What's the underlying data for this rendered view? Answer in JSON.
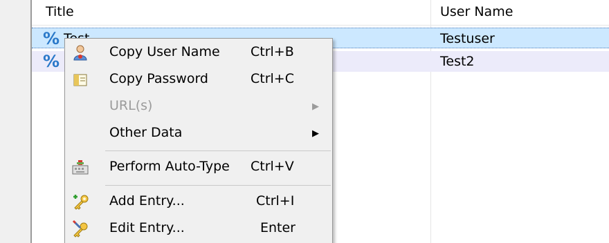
{
  "list": {
    "columns": {
      "title": "Title",
      "user_name": "User Name"
    },
    "rows": [
      {
        "title": "Test",
        "user_name": "Testuser",
        "icon": "percent-key-icon"
      },
      {
        "title": "",
        "user_name": "Test2",
        "icon": "percent-key-icon"
      }
    ]
  },
  "context_menu": {
    "items": [
      {
        "label": "Copy User Name",
        "shortcut": "Ctrl+B",
        "icon": "user-icon",
        "enabled": true
      },
      {
        "label": "Copy Password",
        "shortcut": "Ctrl+C",
        "icon": "key-icon",
        "enabled": true
      },
      {
        "label": "URL(s)",
        "shortcut": "",
        "icon": "",
        "enabled": false,
        "submenu": true
      },
      {
        "label": "Other Data",
        "shortcut": "",
        "icon": "",
        "enabled": true,
        "submenu": true
      },
      {
        "label": "Perform Auto-Type",
        "shortcut": "Ctrl+V",
        "icon": "keyboard-icon",
        "enabled": true
      },
      {
        "label": "Add Entry...",
        "shortcut": "Ctrl+I",
        "icon": "add-key-icon",
        "enabled": true
      },
      {
        "label": "Edit Entry...",
        "shortcut": "Enter",
        "icon": "edit-key-icon",
        "enabled": true
      }
    ]
  },
  "colors": {
    "selection": "#cce8ff",
    "alt_row": "#ecebfa",
    "menu_bg": "#f0f0f0",
    "entry_icon": "#2b79c9"
  }
}
